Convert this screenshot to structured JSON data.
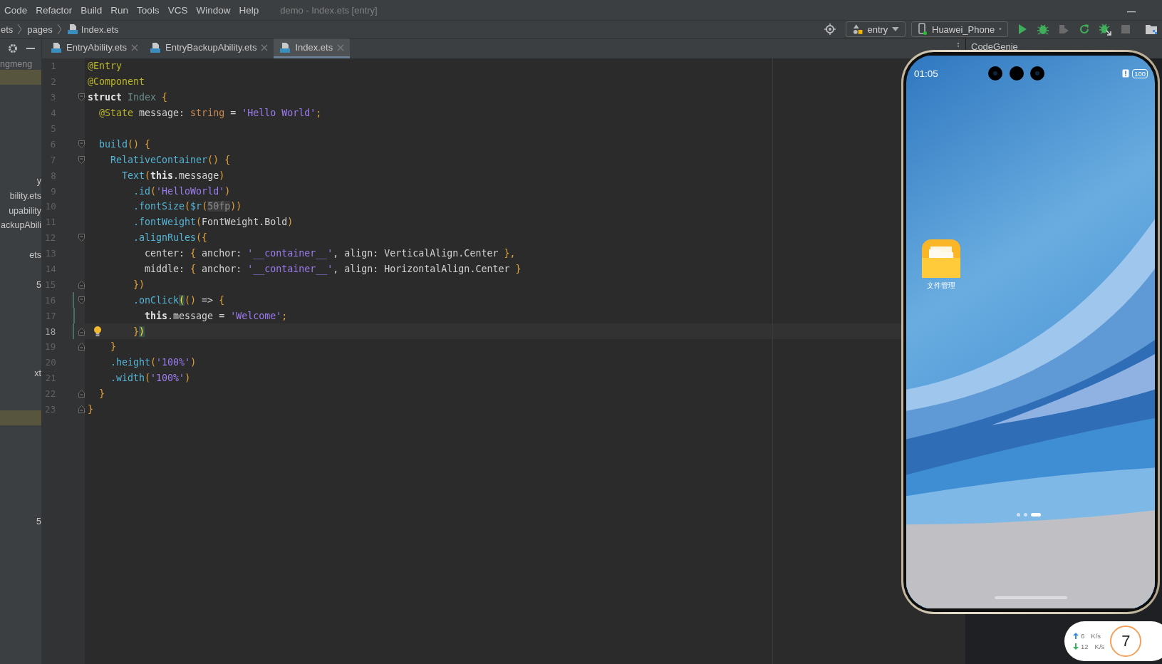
{
  "menu_bar": {
    "items": [
      "Code",
      "Refactor",
      "Build",
      "Run",
      "Tools",
      "VCS",
      "Window",
      "Help"
    ],
    "title": "demo - Index.ets [entry]"
  },
  "navigation_bar": {
    "breadcrumb": [
      {
        "text": "ets",
        "kind": "folder"
      },
      {
        "text": "pages",
        "kind": "folder"
      },
      {
        "text": "Index.ets",
        "kind": "file"
      }
    ],
    "module_selector": "entry",
    "device_selector": "Huawei_Phone",
    "device_connected": true,
    "actions": [
      {
        "kind": "run",
        "enabled": true
      },
      {
        "kind": "debug",
        "enabled": true
      },
      {
        "kind": "attach",
        "enabled": false
      },
      {
        "kind": "apply",
        "enabled": true
      },
      {
        "kind": "debug_attach",
        "enabled": true
      },
      {
        "kind": "stop",
        "enabled": false
      },
      {
        "kind": "device_manager",
        "enabled": true
      }
    ]
  },
  "project_panel": {
    "header": "ngmeng",
    "rows": [
      {
        "selected": true
      },
      {
        "selected": false
      },
      {
        "selected": false
      },
      {
        "selected": false
      },
      {
        "selected": false
      },
      {
        "selected": false
      },
      {
        "selected": false
      },
      {
        "text": "y",
        "selected": false
      },
      {
        "text": "bility.ets",
        "selected": false
      },
      {
        "text": "upability",
        "selected": false
      },
      {
        "text": "ackupAbili",
        "selected": false
      },
      {
        "selected": false
      },
      {
        "text": "ets",
        "selected": false
      },
      {
        "selected": false
      },
      {
        "text": "5",
        "selected": false
      },
      {
        "selected": false
      },
      {
        "selected": false
      },
      {
        "selected": false
      },
      {
        "selected": false
      },
      {
        "selected": false
      },
      {
        "text": "xt",
        "selected": false
      },
      {
        "selected": false
      },
      {
        "selected": false
      },
      {
        "selected": true
      },
      {
        "selected": false
      },
      {
        "selected": false
      },
      {
        "selected": false
      },
      {
        "selected": false
      },
      {
        "selected": false
      },
      {
        "selected": false
      },
      {
        "text": "5",
        "selected": false
      }
    ]
  },
  "editor_tabs": [
    {
      "label": "EntryAbility.ets",
      "selected": false
    },
    {
      "label": "EntryBackupAbility.ets",
      "selected": false
    },
    {
      "label": "Index.ets",
      "selected": true
    }
  ],
  "editor": {
    "lines": [
      {
        "number": "1",
        "current": false,
        "changed": false,
        "tokens": [
          {
            "text": "@Entry",
            "kind": "annotation"
          }
        ]
      },
      {
        "number": "2",
        "current": false,
        "changed": false,
        "tokens": [
          {
            "text": "@Component",
            "kind": "annotation"
          }
        ]
      },
      {
        "number": "3",
        "current": false,
        "changed": false,
        "fold_marker": {
          "kind": "start"
        },
        "tokens": [
          {
            "text": "struct",
            "kind": "keyword"
          },
          {
            "text": " Index",
            "kind": "classname"
          },
          {
            "text": " {",
            "kind": "punct"
          }
        ]
      },
      {
        "number": "4",
        "current": false,
        "changed": false,
        "tokens": [
          {
            "text": "  @State",
            "kind": "annotation"
          },
          {
            "text": " message: ",
            "kind": "plain"
          },
          {
            "text": "string",
            "kind": "type"
          },
          {
            "text": " = ",
            "kind": "plain"
          },
          {
            "text": "'Hello World'",
            "kind": "string"
          },
          {
            "text": ";",
            "kind": "punct"
          }
        ]
      },
      {
        "number": "5",
        "current": false,
        "changed": false
      },
      {
        "number": "6",
        "current": false,
        "changed": false,
        "fold_marker": {
          "kind": "start"
        },
        "tokens": [
          {
            "text": "  build",
            "kind": "call"
          },
          {
            "text": "() {",
            "kind": "punct"
          }
        ]
      },
      {
        "number": "7",
        "current": false,
        "changed": false,
        "fold_marker": {
          "kind": "start"
        },
        "tokens": [
          {
            "text": "    RelativeContainer",
            "kind": "call"
          },
          {
            "text": "() {",
            "kind": "punct"
          }
        ]
      },
      {
        "number": "8",
        "current": false,
        "changed": false,
        "tokens": [
          {
            "text": "      Text",
            "kind": "call"
          },
          {
            "text": "(",
            "kind": "punct"
          },
          {
            "text": "this",
            "kind": "keyword"
          },
          {
            "text": ".message",
            "kind": "plain"
          },
          {
            "text": ")",
            "kind": "punct"
          }
        ]
      },
      {
        "number": "9",
        "current": false,
        "changed": false,
        "tokens": [
          {
            "text": "        .id",
            "kind": "call"
          },
          {
            "text": "(",
            "kind": "punct"
          },
          {
            "text": "'HelloWorld'",
            "kind": "string"
          },
          {
            "text": ")",
            "kind": "punct"
          }
        ]
      },
      {
        "number": "10",
        "current": false,
        "changed": false,
        "tokens": [
          {
            "text": "        .fontSize",
            "kind": "call"
          },
          {
            "text": "(",
            "kind": "punct"
          },
          {
            "text": "$r",
            "kind": "call"
          },
          {
            "text": "(",
            "kind": "punct"
          },
          {
            "text": "50fp",
            "kind": "hint"
          },
          {
            "text": "))",
            "kind": "punct"
          }
        ]
      },
      {
        "number": "11",
        "current": false,
        "changed": false,
        "tokens": [
          {
            "text": "        .fontWeight",
            "kind": "call"
          },
          {
            "text": "(",
            "kind": "punct"
          },
          {
            "text": "FontWeight.Bold",
            "kind": "plain"
          },
          {
            "text": ")",
            "kind": "punct"
          }
        ]
      },
      {
        "number": "12",
        "current": false,
        "changed": false,
        "fold_marker": {
          "kind": "start"
        },
        "tokens": [
          {
            "text": "        .alignRules",
            "kind": "call"
          },
          {
            "text": "({",
            "kind": "punct"
          }
        ]
      },
      {
        "number": "13",
        "current": false,
        "changed": false,
        "tokens": [
          {
            "text": "          center: ",
            "kind": "plain"
          },
          {
            "text": "{ ",
            "kind": "punct"
          },
          {
            "text": "anchor: ",
            "kind": "plain"
          },
          {
            "text": "'__container__'",
            "kind": "string"
          },
          {
            "text": ", align: VerticalAlign.Center ",
            "kind": "plain"
          },
          {
            "text": "},",
            "kind": "punct"
          }
        ]
      },
      {
        "number": "14",
        "current": false,
        "changed": false,
        "tokens": [
          {
            "text": "          middle: ",
            "kind": "plain"
          },
          {
            "text": "{ ",
            "kind": "punct"
          },
          {
            "text": "anchor: ",
            "kind": "plain"
          },
          {
            "text": "'__container__'",
            "kind": "string"
          },
          {
            "text": ", align: HorizontalAlign.Center ",
            "kind": "plain"
          },
          {
            "text": "}",
            "kind": "punct"
          }
        ]
      },
      {
        "number": "15",
        "current": false,
        "changed": false,
        "fold_marker": {
          "kind": "end"
        },
        "tokens": [
          {
            "text": "        })",
            "kind": "punct"
          }
        ]
      },
      {
        "number": "16",
        "current": false,
        "changed": true,
        "fold_marker": {
          "kind": "start"
        },
        "tokens": [
          {
            "text": "        .onClick",
            "kind": "call"
          },
          {
            "text": "(",
            "kind": "match"
          },
          {
            "text": "()",
            "kind": "punct"
          },
          {
            "text": " => ",
            "kind": "plain"
          },
          {
            "text": "{",
            "kind": "punct"
          }
        ]
      },
      {
        "number": "17",
        "current": false,
        "changed": true,
        "tokens": [
          {
            "text": "          this",
            "kind": "keyword"
          },
          {
            "text": ".message = ",
            "kind": "plain"
          },
          {
            "text": "'Welcome'",
            "kind": "string"
          },
          {
            "text": ";",
            "kind": "punct"
          }
        ]
      },
      {
        "number": "18",
        "current": true,
        "changed": true,
        "bulb": true,
        "fold_marker": {
          "kind": "end"
        },
        "tokens": [
          {
            "text": "        }",
            "kind": "punct"
          },
          {
            "text": ")",
            "kind": "match"
          }
        ]
      },
      {
        "number": "19",
        "current": false,
        "changed": false,
        "fold_marker": {
          "kind": "end"
        },
        "tokens": [
          {
            "text": "    }",
            "kind": "punct"
          }
        ]
      },
      {
        "number": "20",
        "current": false,
        "changed": false,
        "tokens": [
          {
            "text": "    .height",
            "kind": "call"
          },
          {
            "text": "(",
            "kind": "punct"
          },
          {
            "text": "'100%'",
            "kind": "string"
          },
          {
            "text": ")",
            "kind": "punct"
          }
        ]
      },
      {
        "number": "21",
        "current": false,
        "changed": false,
        "tokens": [
          {
            "text": "    .width",
            "kind": "call"
          },
          {
            "text": "(",
            "kind": "punct"
          },
          {
            "text": "'100%'",
            "kind": "string"
          },
          {
            "text": ")",
            "kind": "punct"
          }
        ]
      },
      {
        "number": "22",
        "current": false,
        "changed": false,
        "fold_marker": {
          "kind": "end"
        },
        "tokens": [
          {
            "text": "  }",
            "kind": "punct"
          }
        ]
      },
      {
        "number": "23",
        "current": false,
        "changed": false,
        "fold_marker": {
          "kind": "end"
        },
        "tokens": [
          {
            "text": "}",
            "kind": "punct"
          }
        ]
      }
    ]
  },
  "side_panel": {
    "title": "CodeGenie"
  },
  "emulator": {
    "time": "01:05",
    "battery": "100",
    "apps": [
      {
        "label": "文件管理"
      }
    ],
    "page_dots": [
      {
        "selected": false
      },
      {
        "selected": false
      },
      {
        "selected": true
      }
    ]
  },
  "net_monitor": {
    "upload": "6",
    "upload_unit": "K/s",
    "download": "12",
    "download_unit": "K/s",
    "badge": "7"
  }
}
